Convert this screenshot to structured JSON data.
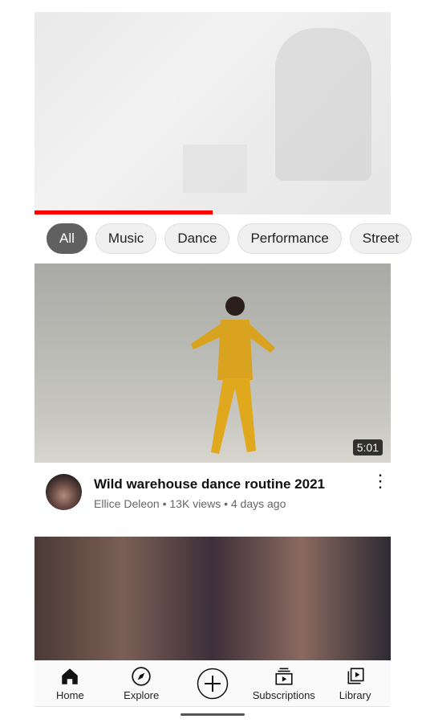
{
  "player": {
    "progress_percent": 50
  },
  "chips": [
    "All",
    "Music",
    "Dance",
    "Performance",
    "Street"
  ],
  "active_chip": "All",
  "videos": [
    {
      "title": "Wild warehouse dance routine 2021",
      "channel": "Ellice Deleon",
      "views": "13K views",
      "age": "4 days ago",
      "duration": "5:01",
      "subtitle": "Ellice Deleon • 13K views • 4 days ago"
    }
  ],
  "nav": {
    "home": "Home",
    "explore": "Explore",
    "create_icon": "plus-circle-icon",
    "subscriptions": "Subscriptions",
    "library": "Library"
  },
  "colors": {
    "progress": "#ff0000",
    "active_chip": "#606060"
  }
}
